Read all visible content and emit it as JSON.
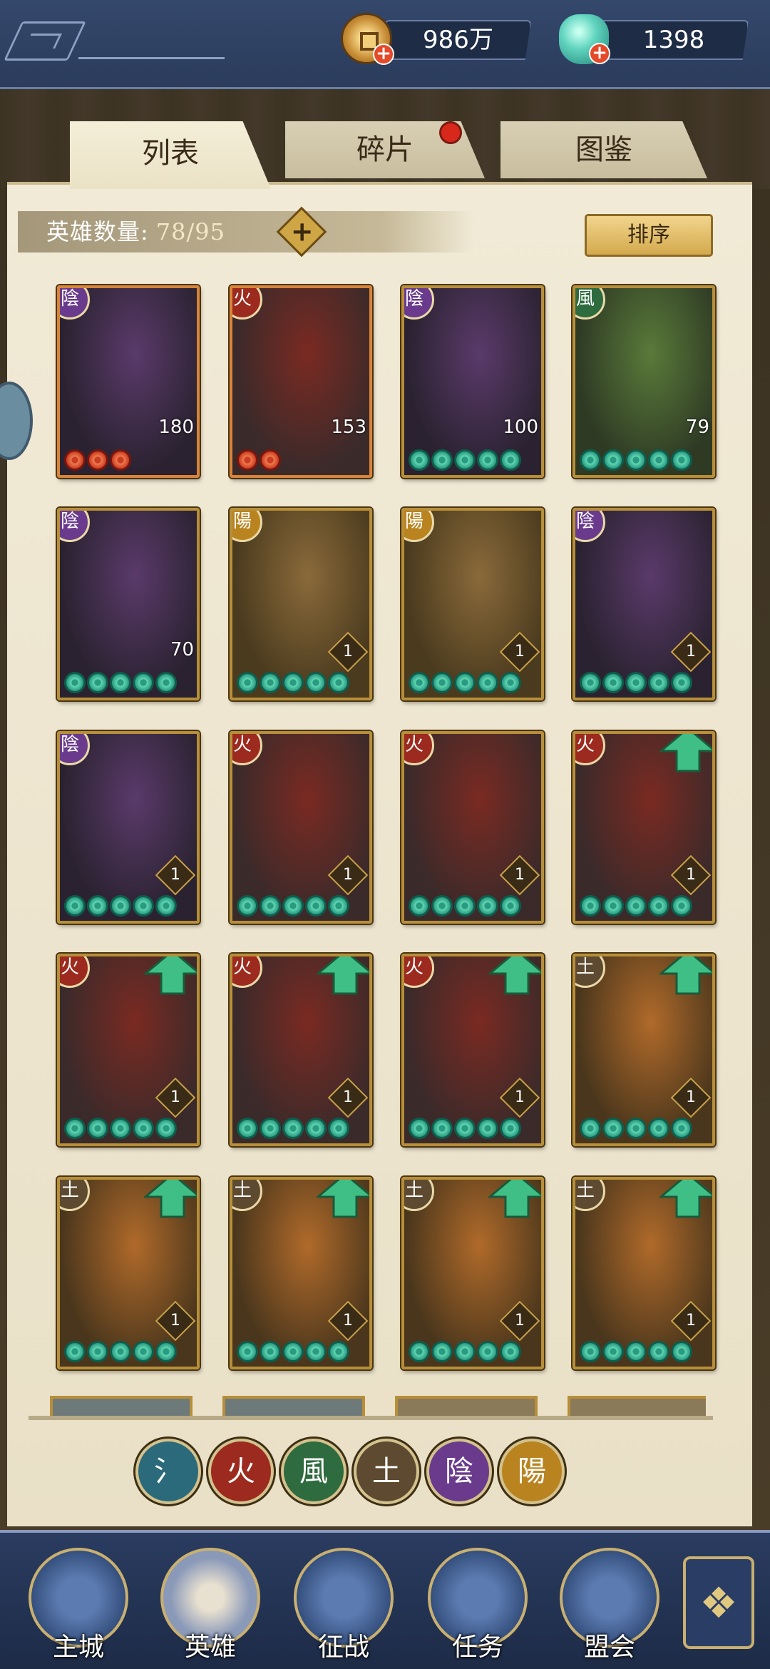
{
  "currency": {
    "coins": "986万",
    "gems": "1398"
  },
  "tabs": [
    {
      "label": "列表",
      "active": true
    },
    {
      "label": "碎片",
      "has_notification": true
    },
    {
      "label": "图鉴"
    }
  ],
  "hero_count": {
    "label": "英雄数量:",
    "value": "78/95"
  },
  "sort_label": "排序",
  "elements": {
    "water": "氵",
    "fire": "火",
    "wind": "風",
    "earth": "土",
    "yin": "陰",
    "yang": "陽"
  },
  "heroes": [
    {
      "element": "陰",
      "level": "180",
      "stars": 3,
      "star_color": "red",
      "upgrade": false
    },
    {
      "element": "火",
      "level": "153",
      "stars": 2,
      "star_color": "red",
      "upgrade": false
    },
    {
      "element": "陰",
      "level": "100",
      "stars": 5,
      "star_color": "green",
      "upgrade": false
    },
    {
      "element": "風",
      "level": "79",
      "stars": 5,
      "star_color": "green",
      "upgrade": false
    },
    {
      "element": "陰",
      "level": "70",
      "stars": 5,
      "star_color": "green",
      "upgrade": false
    },
    {
      "element": "陽",
      "level": "1",
      "stars": 5,
      "star_color": "green",
      "upgrade": false
    },
    {
      "element": "陽",
      "level": "1",
      "stars": 5,
      "star_color": "green",
      "upgrade": false
    },
    {
      "element": "陰",
      "level": "1",
      "stars": 5,
      "star_color": "green",
      "upgrade": false
    },
    {
      "element": "陰",
      "level": "1",
      "stars": 5,
      "star_color": "green",
      "upgrade": false
    },
    {
      "element": "火",
      "level": "1",
      "stars": 5,
      "star_color": "green",
      "upgrade": false
    },
    {
      "element": "火",
      "level": "1",
      "stars": 5,
      "star_color": "green",
      "upgrade": false
    },
    {
      "element": "火",
      "level": "1",
      "stars": 5,
      "star_color": "green",
      "upgrade": true
    },
    {
      "element": "火",
      "level": "1",
      "stars": 5,
      "star_color": "green",
      "upgrade": true
    },
    {
      "element": "火",
      "level": "1",
      "stars": 5,
      "star_color": "green",
      "upgrade": true
    },
    {
      "element": "火",
      "level": "1",
      "stars": 5,
      "star_color": "green",
      "upgrade": true
    },
    {
      "element": "土",
      "level": "1",
      "stars": 5,
      "star_color": "green",
      "upgrade": true
    },
    {
      "element": "土",
      "level": "1",
      "stars": 5,
      "star_color": "green",
      "upgrade": true
    },
    {
      "element": "土",
      "level": "1",
      "stars": 5,
      "star_color": "green",
      "upgrade": true
    },
    {
      "element": "土",
      "level": "1",
      "stars": 5,
      "star_color": "green",
      "upgrade": true
    },
    {
      "element": "土",
      "level": "1",
      "stars": 5,
      "star_color": "green",
      "upgrade": true
    }
  ],
  "nav": [
    {
      "label": "主城",
      "icon": "city-gate-icon"
    },
    {
      "label": "英雄",
      "icon": "hero-portrait-icon"
    },
    {
      "label": "征战",
      "icon": "battle-icon"
    },
    {
      "label": "任务",
      "icon": "quest-scroll-icon"
    },
    {
      "label": "盟会",
      "icon": "guild-icon"
    }
  ],
  "colors": {
    "fire": "#9c2a1e",
    "yin": "#6a3b8d",
    "yang": "#b98420",
    "wind": "#2e6b3e",
    "earth": "#5e4a30",
    "water": "#2a6a7a"
  }
}
